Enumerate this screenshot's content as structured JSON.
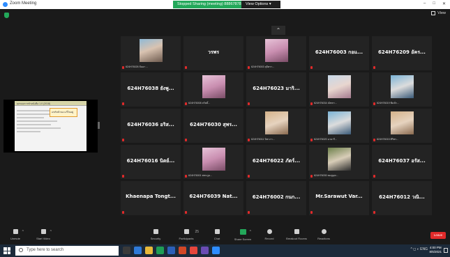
{
  "window": {
    "title": "Zoom Meeting",
    "banner_text": "Stopped Sharing (meeting) 88867878 viewed",
    "view_options": "View Options ▾",
    "controls": [
      "–",
      "□",
      "✕"
    ]
  },
  "meeting": {
    "view_label": "View",
    "collapse": "⌃",
    "shared_screen": {
      "header": "ผลของการทำหนังสือ 1.0 (2018)",
      "popup": "แชร์หน้าจอ แก้ไขอยู่"
    },
    "participants": [
      {
        "type": "photo",
        "sub": "624H76026 ธันยา ...",
        "photo": "p1"
      },
      {
        "type": "name",
        "name": "วรพร",
        "sub": ""
      },
      {
        "type": "photo",
        "sub": "624H76003 สุจิตรา...",
        "photo": "p2"
      },
      {
        "type": "name",
        "name": "624H76003 กอแ...",
        "sub": ""
      },
      {
        "type": "name",
        "name": "624H76209 อัคร...",
        "sub": ""
      },
      {
        "type": "name",
        "name": "624H76038 ยังพู...",
        "sub": ""
      },
      {
        "type": "photo",
        "sub": "624H76008 สวัสดิ์...",
        "photo": "p2"
      },
      {
        "type": "name",
        "name": "624H76023 มาริ...",
        "sub": ""
      },
      {
        "type": "photo",
        "sub": "624H76034 ณัชชา...",
        "photo": "p7"
      },
      {
        "type": "photo",
        "sub": "624H76019 พิมพ์ร...",
        "photo": "p5"
      },
      {
        "type": "name",
        "name": "624H76036 อริส...",
        "sub": ""
      },
      {
        "type": "name",
        "name": "624H76030 สุพร...",
        "sub": ""
      },
      {
        "type": "photo",
        "sub": "624H76011 นิชาภา...",
        "photo": "p4"
      },
      {
        "type": "photo",
        "sub": "624H76020 ฉายาริ...",
        "photo": "p5"
      },
      {
        "type": "photo",
        "sub": "624H76015 ศิริพร...",
        "photo": "p4"
      },
      {
        "type": "name",
        "name": "624H76016 นิตย์...",
        "sub": ""
      },
      {
        "type": "photo",
        "sub": "624H76001 พชรภูม...",
        "photo": "p2"
      },
      {
        "type": "name",
        "name": "624H76022 ภัตร์...",
        "sub": ""
      },
      {
        "type": "photo",
        "sub": "624H76030 ชมพูนุท...",
        "photo": "p6"
      },
      {
        "type": "name",
        "name": "624H76037 อรัส...",
        "sub": ""
      },
      {
        "type": "name",
        "name": "Khaenapa Tongt...",
        "sub": ""
      },
      {
        "type": "name",
        "name": "624H76039 Nat...",
        "sub": ""
      },
      {
        "type": "name",
        "name": "624H76002 กนก...",
        "sub": ""
      },
      {
        "type": "name",
        "name": "Mr.Sarawut Var...",
        "sub": ""
      },
      {
        "type": "name",
        "name": "624H76012 วณิ...",
        "sub": ""
      }
    ]
  },
  "toolbar": {
    "unmute": "Unmute",
    "start_video": "Start Video",
    "security": "Security",
    "participants": "Participants",
    "participants_count": "25",
    "chat": "Chat",
    "share_screen": "Share Screen",
    "record": "Record",
    "breakout": "Breakout Rooms",
    "reactions": "Reactions",
    "end": "Leave"
  },
  "taskbar": {
    "search_placeholder": "Type here to search",
    "time": "4:00 PM",
    "date": "8/6/2021",
    "tray": "^  ◻  ◐  ENG"
  }
}
